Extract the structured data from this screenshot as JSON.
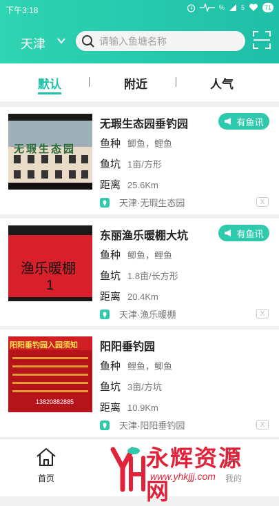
{
  "status_bar": {
    "time": "下午3:18",
    "signal_a": "%",
    "signal_b": "5",
    "battery": "71"
  },
  "header": {
    "city": "天津",
    "search_placeholder": "请输入鱼塘名称"
  },
  "tabs": [
    {
      "label": "默认"
    },
    {
      "label": "附近"
    },
    {
      "label": "人气"
    }
  ],
  "listing_labels": {
    "species": "鱼种",
    "pond": "鱼坑",
    "distance": "距离",
    "close": "X"
  },
  "listings": [
    {
      "name": "无瑕生态园垂钓园",
      "badge": "有鱼讯",
      "species": "鲫鱼，鲤鱼",
      "pond": "1亩/方形",
      "distance": "25.6Km",
      "location": "天津·无瑕生态园",
      "photo_sign": "无瑕生态园"
    },
    {
      "name": "东丽渔乐暖棚大坑",
      "badge": "有鱼讯",
      "species": "鲫鱼，鲤鱼",
      "pond": "1.8亩/长方形",
      "distance": "20.4Km",
      "location": "天津·渔乐暖棚",
      "photo_sign": "渔乐暖棚",
      "photo_sign_2": "1"
    },
    {
      "name": "阳阳垂钓园",
      "species": "鲤鱼，鲫鱼",
      "pond": "3亩/方坑",
      "distance": "10.9Km",
      "location": "天津·阳阳垂钓园",
      "photo_sign": "阳阳垂钓园入园须知",
      "photo_phone": "13820882885"
    }
  ],
  "bottom_nav": {
    "home": "首页",
    "me": "我的"
  },
  "watermark": {
    "title": "永辉资源网",
    "url": "www.yhkjjj.com"
  },
  "colors": {
    "accent": "#1fbfa8",
    "badge": "#2fc9ae",
    "watermark": "#e0233a"
  }
}
